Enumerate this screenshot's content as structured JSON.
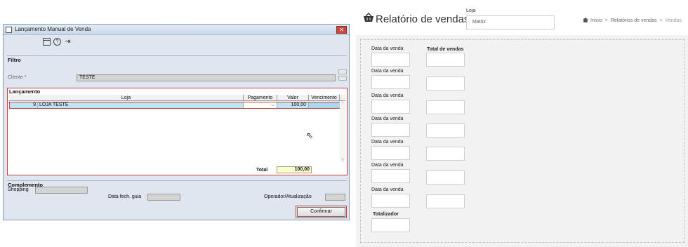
{
  "dialog": {
    "title": "Lançamento Manual de Venda",
    "icons": [
      "calendar-icon",
      "help-icon",
      "exit-icon"
    ],
    "filtro": {
      "label": "Filtro",
      "cliente_label": "Cliente *",
      "cliente_value": "TESTE"
    },
    "lancamento": {
      "label": "Lançamento",
      "columns": [
        "Loja",
        "Pagamento",
        "Valor",
        "Vencimento"
      ],
      "row": {
        "codigo": "9",
        "loja": "LOJA TESTE",
        "pagamento": "",
        "valor": "100,00",
        "vencimento": ""
      },
      "total_label": "Total",
      "total_value": "100,00"
    },
    "complemento": {
      "label": "Complemento",
      "shopping_label": "Shopping",
      "data_fech_label": "Data fech. guia",
      "operador_label": "Operador/Atualização"
    },
    "confirm_label": "Confirmar"
  },
  "report": {
    "title": "Relatório de vendas",
    "loja_label": "Loja",
    "loja_value": "Matriz",
    "breadcrumb": [
      "Início",
      "Relatórios de vendas",
      "Vendas"
    ],
    "data_label": "Data da venda",
    "total_label": "Total de vendas",
    "totalizador_label": "Totalizador"
  },
  "colors": {
    "highlight_red": "#d13b3b",
    "row_blue": "#bfe4f4",
    "total_yellow": "#ffffcc"
  }
}
